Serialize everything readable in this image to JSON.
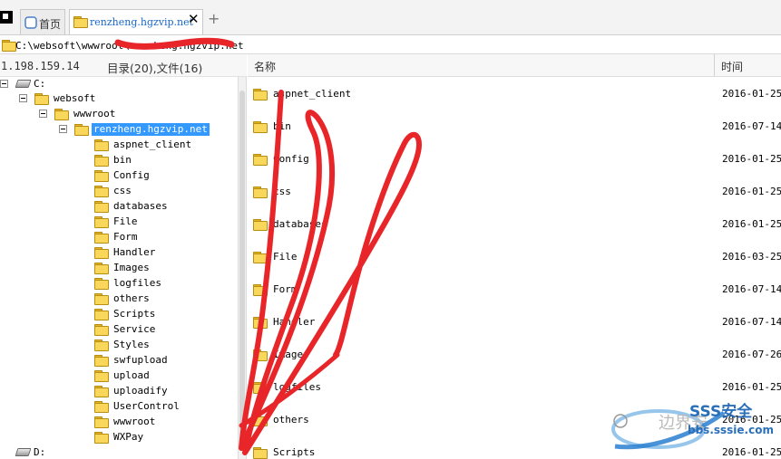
{
  "tabs": {
    "home_label": "首页",
    "active_label": "renzheng.hgzvip.net",
    "close_symbol": "✕",
    "new_tab_symbol": "+"
  },
  "pathbar": {
    "path": "C:\\websoft\\wwwroot\\renzheng.hgzvip.net"
  },
  "infobar": {
    "ip": "1.198.159.14",
    "counts": "目录(20),文件(16)"
  },
  "list_header": {
    "name": "名称",
    "time": "时间"
  },
  "tree": {
    "drive_c": "C:",
    "websoft": "websoft",
    "wwwroot": "wwwroot",
    "site": "renzheng.hgzvip.net",
    "children": [
      "aspnet_client",
      "bin",
      "Config",
      "css",
      "databases",
      "File",
      "Form",
      "Handler",
      "Images",
      "logfiles",
      "others",
      "Scripts",
      "Service",
      "Styles",
      "swfupload",
      "upload",
      "uploadify",
      "UserControl",
      "wwwroot",
      "WXPay"
    ],
    "drive_d": "D:"
  },
  "list": [
    {
      "name": "aspnet_client",
      "time": "2016-01-25"
    },
    {
      "name": "bin",
      "time": "2016-07-14"
    },
    {
      "name": "Config",
      "time": "2016-01-25"
    },
    {
      "name": "css",
      "time": "2016-01-25"
    },
    {
      "name": "databases",
      "time": "2016-01-25"
    },
    {
      "name": "File",
      "time": "2016-03-25"
    },
    {
      "name": "Form",
      "time": "2016-07-14"
    },
    {
      "name": "Handler",
      "time": "2016-07-14"
    },
    {
      "name": "Images",
      "time": "2016-07-26"
    },
    {
      "name": "logfiles",
      "time": "2016-01-25"
    },
    {
      "name": "others",
      "time": "2016-01-25"
    },
    {
      "name": "Scripts",
      "time": "2016-01-25"
    }
  ],
  "watermark": {
    "brand": "SSS安全",
    "site": "bbs.sssie.com",
    "cn": "边界安"
  },
  "colors": {
    "selection": "#3399ff",
    "scribble": "#e8262a",
    "tab_text": "#1a66c7",
    "folder": "#f8d75a"
  }
}
